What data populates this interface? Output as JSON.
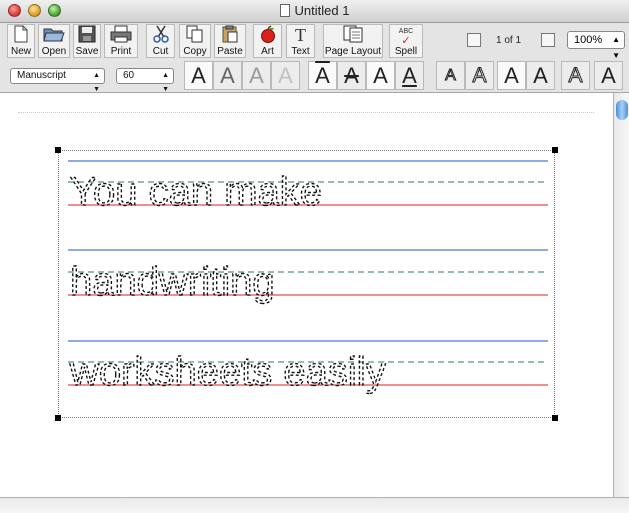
{
  "window": {
    "title": "Untitled 1"
  },
  "toolbar": {
    "buttons": [
      {
        "label": "New",
        "icon": "new-doc-icon"
      },
      {
        "label": "Open",
        "icon": "open-folder-icon"
      },
      {
        "label": "Save",
        "icon": "floppy-icon"
      },
      {
        "label": "Print",
        "icon": "printer-icon"
      },
      {
        "label": "Cut",
        "icon": "scissors-icon"
      },
      {
        "label": "Copy",
        "icon": "copy-icon"
      },
      {
        "label": "Paste",
        "icon": "clipboard-icon"
      },
      {
        "label": "Art",
        "icon": "apple-icon"
      },
      {
        "label": "Text",
        "icon": "text-t-icon"
      },
      {
        "label": "Page Layout",
        "icon": "pages-icon"
      },
      {
        "label": "Spell",
        "icon": "spell-check-icon"
      }
    ],
    "spell_badge": "ABC",
    "page_indicator": "1 of 1",
    "zoom": "100%"
  },
  "format": {
    "font": "Manuscript",
    "size": "60",
    "style_glyph": "A"
  },
  "document": {
    "lines": [
      "You can make",
      "handwriting",
      "worksheets easily"
    ]
  },
  "colors": {
    "guide_top": "#2255cc",
    "guide_mid": "#2a7a6a",
    "guide_base": "#dd2222",
    "selection_thumb": "#4d8fd8"
  }
}
